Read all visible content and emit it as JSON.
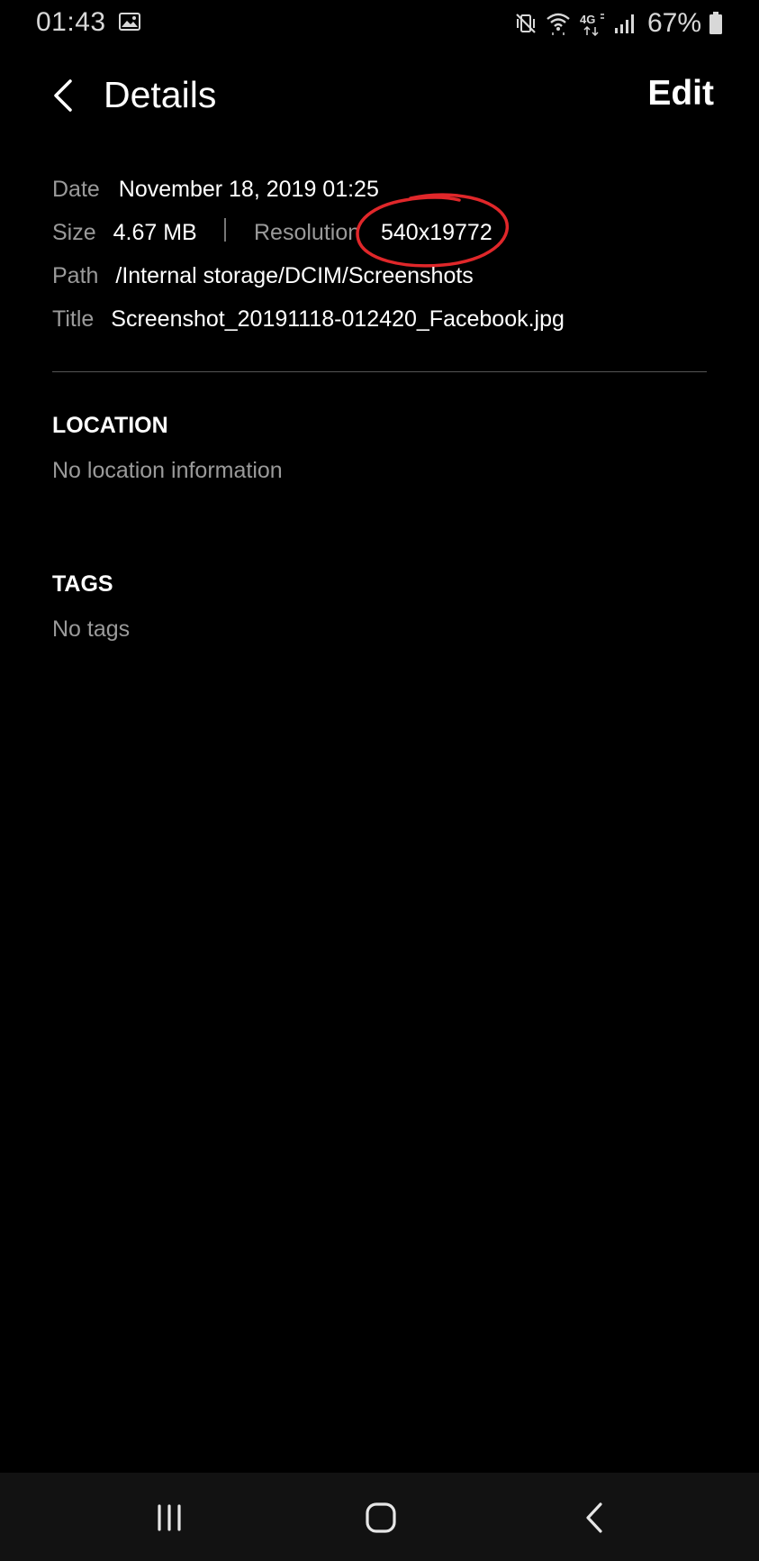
{
  "status_bar": {
    "time": "01:43",
    "battery_percent": "67%",
    "icons": [
      "gallery-icon",
      "mute-vibrate-icon",
      "wifi-icon",
      "lte-4g-icon",
      "signal-icon",
      "battery-icon"
    ]
  },
  "app_bar": {
    "title": "Details",
    "edit_label": "Edit",
    "back_icon": "chevron-left-icon"
  },
  "details": {
    "date_label": "Date",
    "date_value": "November 18, 2019 01:25",
    "size_label": "Size",
    "size_value": "4.67 MB",
    "resolution_label": "Resolution",
    "resolution_value": "540x19772",
    "path_label": "Path",
    "path_value": "/Internal storage/DCIM/Screenshots",
    "title_label": "Title",
    "title_value": "Screenshot_20191118-012420_Facebook.jpg"
  },
  "location": {
    "header": "LOCATION",
    "body": "No location information"
  },
  "tags": {
    "header": "TAGS",
    "body": "No tags"
  },
  "annotation": {
    "shape": "hand-drawn-circle",
    "color": "#e0272a"
  },
  "nav_bar": {
    "icons": [
      "recents-icon",
      "home-icon",
      "back-icon"
    ]
  },
  "colors": {
    "background": "#000000",
    "label": "#9a9a9a",
    "value": "#ffffff",
    "nav_bar": "#121212"
  }
}
